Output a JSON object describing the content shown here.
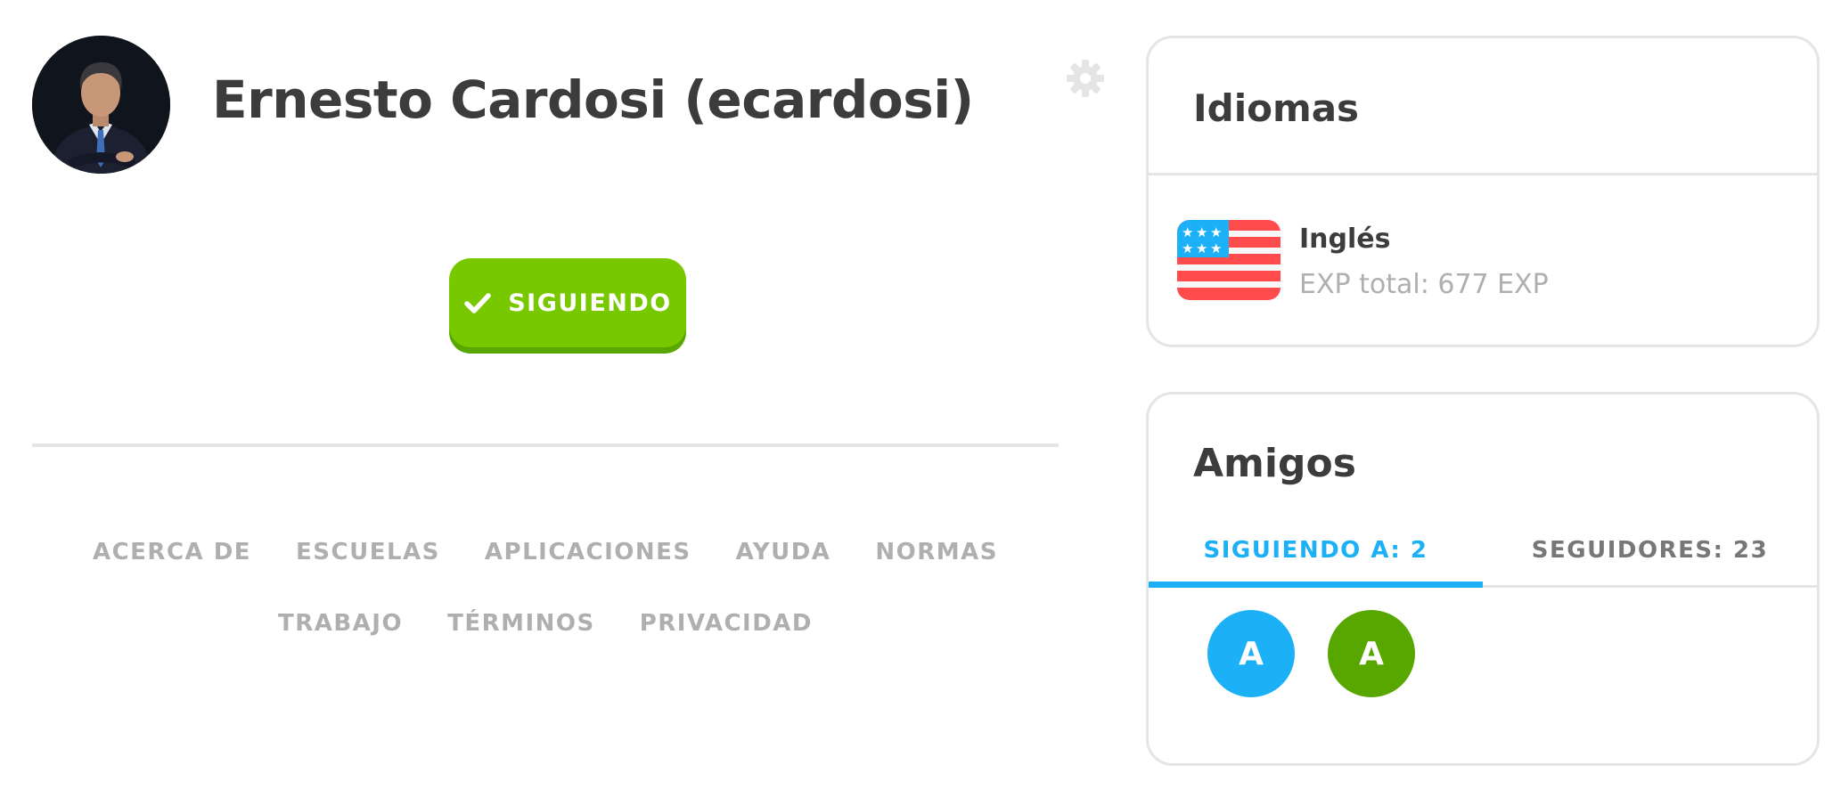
{
  "profile": {
    "name": "Ernesto Cardosi (ecardosi)",
    "follow_button_label": "SIGUIENDO"
  },
  "footer": {
    "links": [
      "ACERCA DE",
      "ESCUELAS",
      "APLICACIONES",
      "AYUDA",
      "NORMAS",
      "TRABAJO",
      "TÉRMINOS",
      "PRIVACIDAD"
    ]
  },
  "languages": {
    "title": "Idiomas",
    "items": [
      {
        "name": "Inglés",
        "xp": "EXP total: 677 EXP",
        "icon": "us-flag-icon"
      }
    ]
  },
  "friends": {
    "title": "Amigos",
    "tabs": [
      {
        "label": "SIGUIENDO A: 2",
        "active": true
      },
      {
        "label": "SEGUIDORES: 23",
        "active": false
      }
    ],
    "avatars": [
      {
        "letter": "A",
        "color": "#1cb0f6"
      },
      {
        "letter": "A",
        "color": "#58a700"
      }
    ]
  },
  "colors": {
    "accent_blue": "#1cb0f6",
    "button_green": "#78c800",
    "button_green_shadow": "#58a700",
    "muted_gray": "#afafaf",
    "border_gray": "#e5e5e5"
  },
  "icons": {
    "settings": "gear-icon",
    "follow_check": "check-icon"
  }
}
